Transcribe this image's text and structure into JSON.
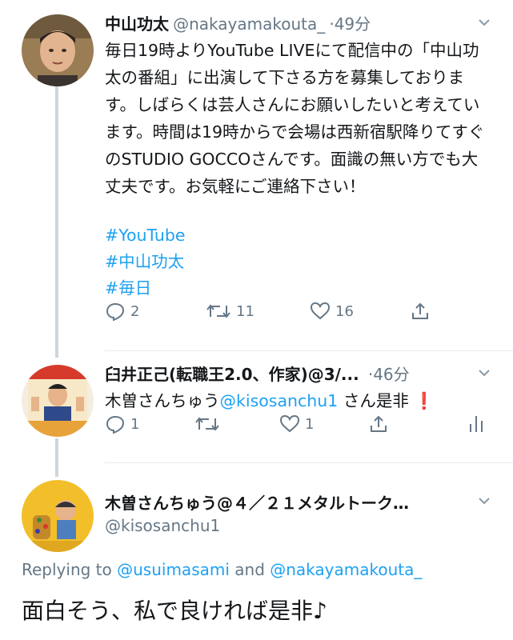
{
  "tweet1": {
    "name": "中山功太",
    "handle": "@nakayamakouta_",
    "time": "49分",
    "text": "毎日19時よりYouTube LIVEにて配信中の「中山功太の番組」に出演して下さる方を募集しております。しばらくは芸人さんにお願いしたいと考えています。時間は19時からで会場は西新宿駅降りてすぐのSTUDIO GOCCOさんです。面識の無い方でも大丈夫です。お気軽にご連絡下さい！",
    "hashtags": [
      "#YouTube",
      "#中山功太",
      "#毎日"
    ],
    "reply_count": "2",
    "retweet_count": "11",
    "like_count": "16"
  },
  "tweet2": {
    "name": "臼井正己(転職王2.0、作家)@3/...",
    "time": "46分",
    "text_prefix": "木曽さんちゅう",
    "mention": "@kisosanchu1",
    "text_suffix": " さん是非",
    "emoji": "❗",
    "reply_count": "1",
    "like_count": "1"
  },
  "tweet3": {
    "name": "木曽さんちゅう@４／２１メタルトーク…",
    "handle": "@kisosanchu1",
    "replying_prefix": "Replying to ",
    "replying_user1": "@usuimasami",
    "replying_and": " and ",
    "replying_user2": "@nakayamakouta_",
    "text": "面白そう、私で良ければ是非♪"
  },
  "colors": {
    "accent": "#1da1f2",
    "muted": "#657786",
    "line": "#ccd6dd",
    "emoji_red": "#e0245e"
  }
}
